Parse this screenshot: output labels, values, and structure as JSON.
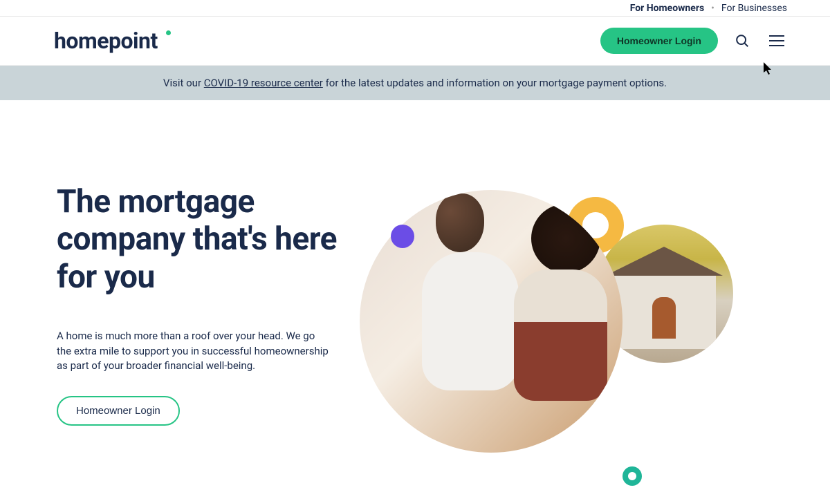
{
  "topbar": {
    "homeowners": "For Homeowners",
    "businesses": "For Businesses"
  },
  "header": {
    "logo": "homepoint",
    "login": "Homeowner Login"
  },
  "banner": {
    "prefix": "Visit our ",
    "link": "COVID-19 resource center",
    "suffix": " for the latest updates and information on your mortgage payment options."
  },
  "hero": {
    "title": "The mortgage company that's here for you",
    "body": "A home is much more than a roof over your head. We go the extra mile to support you in successful homeownership as part of your broader financial well-being.",
    "cta": "Homeowner Login"
  }
}
